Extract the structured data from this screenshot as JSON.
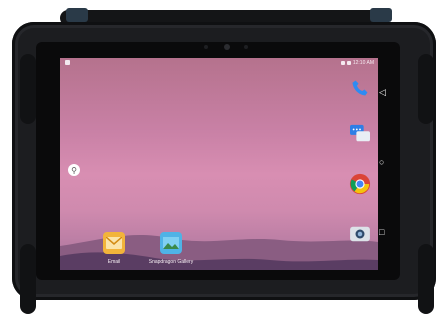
{
  "status_bar": {
    "time": "12:10 AM"
  },
  "home_screen": {
    "search_icon": "search-icon",
    "dock_apps": [
      {
        "label": "Email",
        "icon": "email-icon"
      },
      {
        "label": "Snapdragon Gallery",
        "icon": "gallery-icon"
      }
    ],
    "side_apps": [
      {
        "icon": "phone-icon"
      },
      {
        "icon": "messages-icon"
      },
      {
        "icon": "chrome-icon"
      },
      {
        "icon": "camera-icon"
      }
    ]
  },
  "navigation": {
    "back_icon": "back-icon",
    "home_icon": "home-icon",
    "recents_icon": "recents-icon"
  },
  "colors": {
    "wallpaper_top": "#b5728d",
    "wallpaper_mid": "#d88eb2",
    "device_body": "#1c1d20"
  }
}
